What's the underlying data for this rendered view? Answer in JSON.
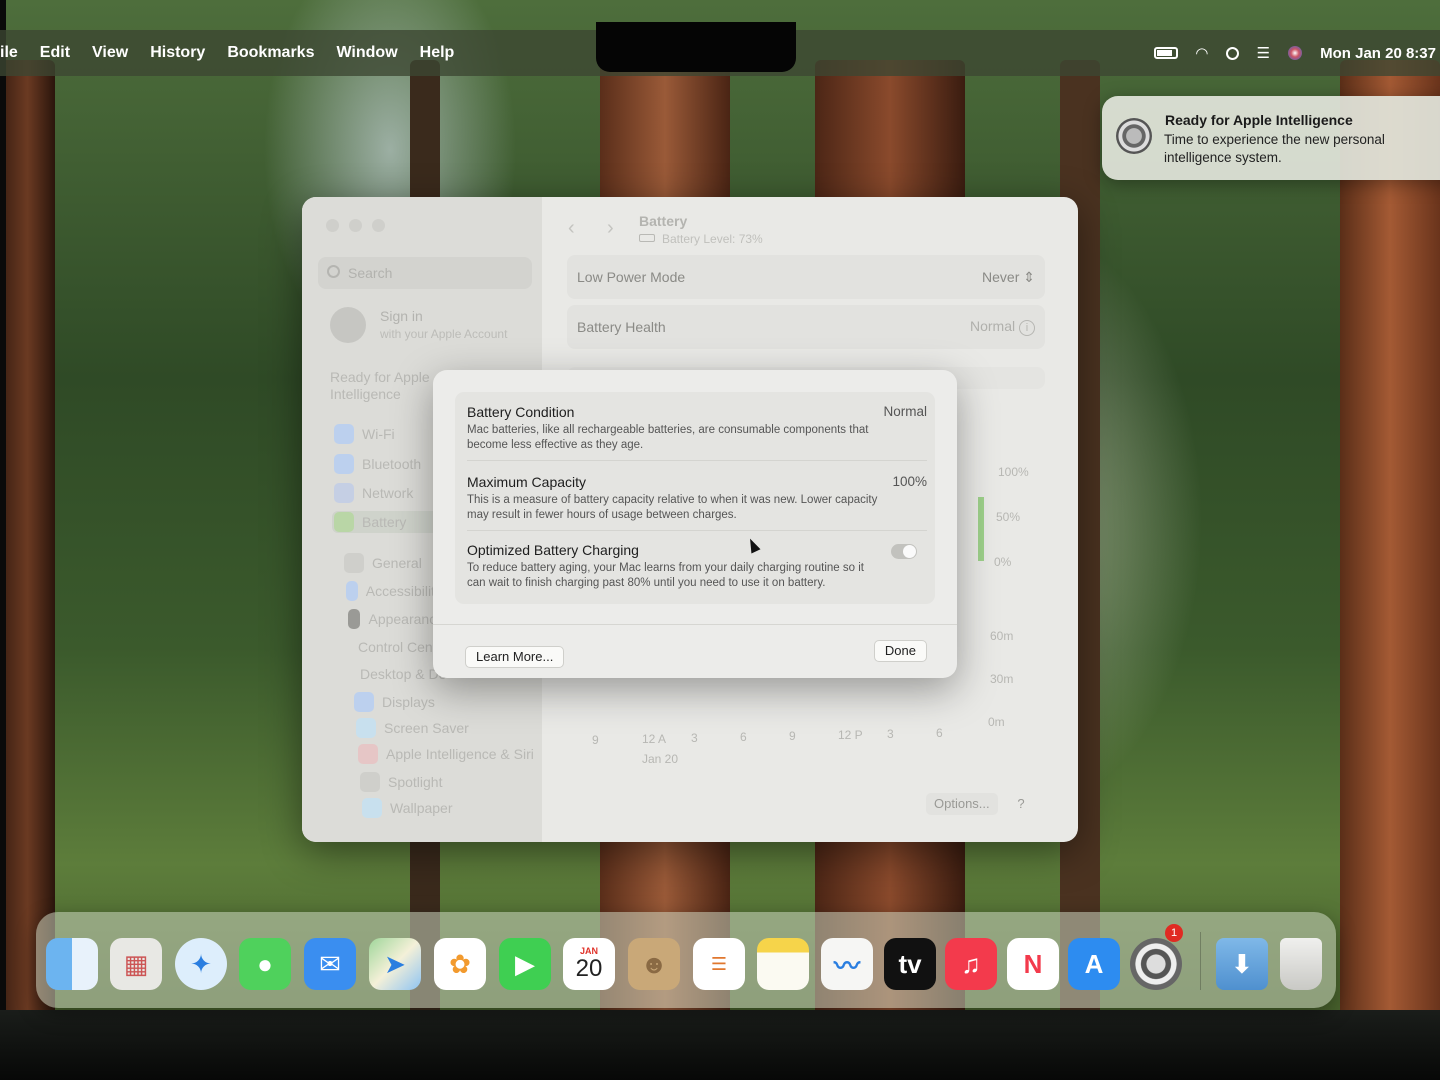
{
  "menubar": {
    "items": [
      "ile",
      "Edit",
      "View",
      "History",
      "Bookmarks",
      "Window",
      "Help"
    ],
    "clock": "Mon Jan 20  8:37",
    "status_icons": [
      "battery-icon",
      "wifi-icon",
      "spotlight-search-icon",
      "control-center-icon",
      "siri-icon"
    ]
  },
  "notification": {
    "title": "Ready for Apple Intelligence",
    "body": "Time to experience the new personal intelligence system."
  },
  "settings": {
    "search_placeholder": "Search",
    "signin_title": "Sign in",
    "signin_sub": "with your Apple Account",
    "ready_promo": "Ready for Apple Intelligence",
    "sidebar": [
      "Wi-Fi",
      "Bluetooth",
      "Network",
      "Battery",
      "General",
      "Accessibility",
      "Appearance",
      "Control Centre",
      "Desktop & Dock",
      "Displays",
      "Screen Saver",
      "Apple Intelligence & Siri",
      "Spotlight",
      "Wallpaper"
    ],
    "title": "Battery",
    "subtitle": "Battery Level: 73%",
    "low_power_label": "Low Power Mode",
    "low_power_value": "Never",
    "health_label": "Battery Health",
    "health_value": "Normal",
    "chart_y_level": [
      "100%",
      "50%",
      "0%"
    ],
    "chart_y_usage": [
      "60m",
      "30m",
      "0m"
    ],
    "chart_x": [
      "9",
      "12 A",
      "3",
      "6",
      "9",
      "12 P",
      "3",
      "6"
    ],
    "chart_date": "Jan 20",
    "options_button": "Options...",
    "help_button": "?"
  },
  "dialog": {
    "condition_title": "Battery Condition",
    "condition_value": "Normal",
    "condition_desc": "Mac batteries, like all rechargeable batteries, are consumable components that become less effective as they age.",
    "capacity_title": "Maximum Capacity",
    "capacity_value": "100%",
    "capacity_desc": "This is a measure of battery capacity relative to when it was new. Lower capacity may result in fewer hours of usage between charges.",
    "optimized_title": "Optimized Battery Charging",
    "optimized_desc": "To reduce battery aging, your Mac learns from your daily charging routine so it can wait to finish charging past 80% until you need to use it on battery.",
    "optimized_on": false,
    "learn_more": "Learn More...",
    "done": "Done"
  },
  "dock": {
    "apps": [
      "finder-icon",
      "launchpad-icon",
      "safari-icon",
      "messages-icon",
      "mail-icon",
      "maps-icon",
      "photos-icon",
      "facetime-icon",
      "calendar-icon",
      "contacts-icon",
      "reminders-icon",
      "notes-icon",
      "freeform-icon",
      "tv-icon",
      "music-icon",
      "news-icon",
      "app-store-icon",
      "system-settings-icon",
      "downloads-folder-icon",
      "trash-icon"
    ],
    "calendar_month": "JAN",
    "calendar_day": "20",
    "tv_label": "tv",
    "settings_badge": "1"
  }
}
